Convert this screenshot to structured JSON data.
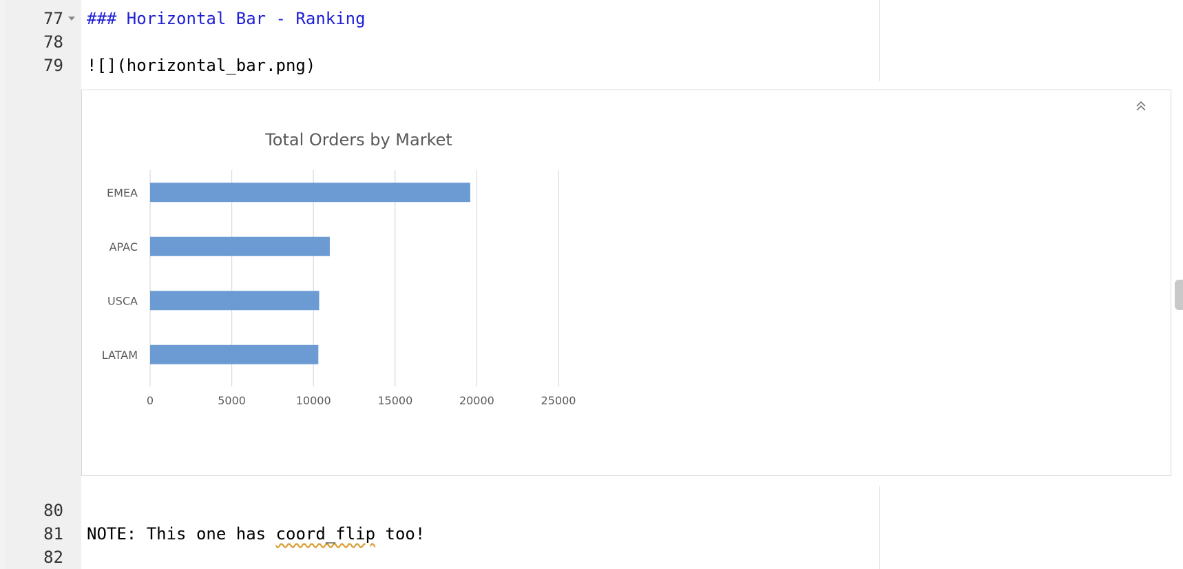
{
  "editor": {
    "lines": [
      {
        "num": "77",
        "text": "### Horizontal Bar - Ranking",
        "kind": "heading"
      },
      {
        "num": "78",
        "text": "",
        "kind": "plain"
      },
      {
        "num": "79",
        "text": "![](horizontal_bar.png)",
        "kind": "plain"
      },
      {
        "num": "80",
        "text": "",
        "kind": "plain"
      },
      {
        "num": "81",
        "text_before": "NOTE: This one has ",
        "text_squiggle": "coord_flip",
        "text_after": " too!",
        "kind": "plain"
      },
      {
        "num": "82",
        "text": "",
        "kind": "plain"
      }
    ]
  },
  "chart_data": {
    "type": "bar",
    "orientation": "horizontal",
    "title": "Total Orders by Market",
    "categories": [
      "EMEA",
      "APAC",
      "USCA",
      "LATAM"
    ],
    "values": [
      19600,
      11000,
      10350,
      10300
    ],
    "xlim": [
      0,
      25000
    ],
    "xticks": [
      "0",
      "5000",
      "10000",
      "15000",
      "20000",
      "25000"
    ],
    "xlabel": "",
    "ylabel": "",
    "grid": "vertical",
    "bar_color": "#6b9bd2"
  },
  "colors": {
    "heading_text": "#1f1fd6",
    "gutter_bg": "#f0f0f0",
    "squiggle": "#d9a23a"
  },
  "icons": {
    "collapse": "double-chevron-up-icon",
    "fold": "fold-arrow-icon"
  }
}
